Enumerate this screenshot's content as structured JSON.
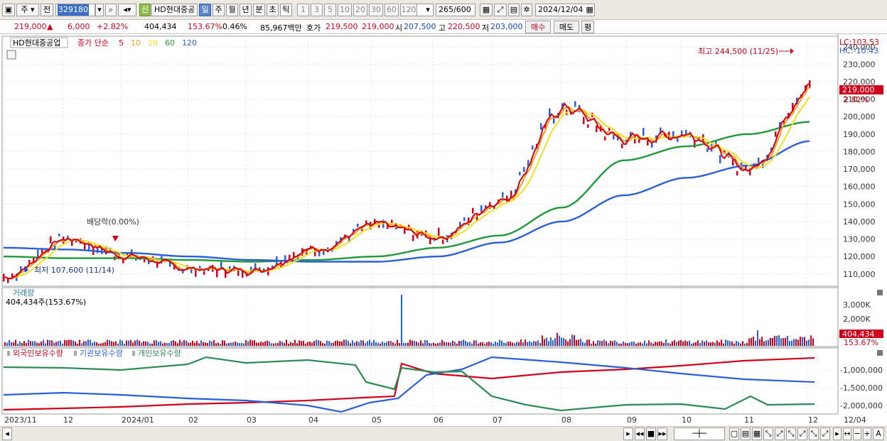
{
  "toolbar": {
    "market_select": "주",
    "prev_label": "전",
    "stock_code": "329180",
    "new_badge": "신",
    "stock_name": "HD현대중공",
    "periods": [
      "일",
      "주",
      "월",
      "년",
      "분",
      "초",
      "틱"
    ],
    "active_period": "일",
    "intervals": [
      "1",
      "3",
      "5",
      "10",
      "20",
      "30",
      "60",
      "120"
    ],
    "count": "265",
    "count_total": "/600",
    "date": "2024/12/04"
  },
  "quote": {
    "price": "219,000",
    "change": "6,000",
    "change_pct": "+2.82%",
    "volume": "404,434",
    "volume_ratio": "153.67%",
    "turnover": "0.46%",
    "amount": "85,967백만",
    "bid_label": "호가",
    "bid": "219,500",
    "ask": "219,000",
    "open_label": "시",
    "open": "207,500",
    "high_label": "고",
    "high": "220,500",
    "low_label": "저",
    "low": "203,000",
    "buy_label": "매수",
    "sell_label": "매도",
    "eval_label": "평"
  },
  "price_panel": {
    "legend_name": "HD현대중공업",
    "legend_ma_label": "종가 단순",
    "ma_periods": [
      "5",
      "10",
      "20",
      "60",
      "120"
    ],
    "ma_colors": [
      "#d0021b",
      "#e8a020",
      "#f0e020",
      "#1e9a3a",
      "#2a5fd8"
    ],
    "lc_label": "LC:103.53",
    "hc_label": "HC:-10.43",
    "price_tag": "219,000",
    "pct_tag": "2.82%",
    "max_annotation": "최고 244,500 (11/25)",
    "min_annotation": "최저 107,600 (11/14)",
    "dividend_annotation": "배당락(0.00%)",
    "y_ticks": [
      "240,000",
      "230,000",
      "220,000",
      "210,000",
      "200,000",
      "190,000",
      "180,000",
      "170,000",
      "160,000",
      "150,000",
      "140,000",
      "130,000",
      "120,000",
      "110,000"
    ]
  },
  "volume_panel": {
    "title": "거래량",
    "value": "404,434주(153.67%)",
    "y_ticks": [
      "3,000K",
      "2,000K"
    ],
    "tag_value": "404,434",
    "tag_pct": "153.67%"
  },
  "holding_panel": {
    "legend": [
      "외국인보유수량",
      "기관보유수량",
      "개인보유수량"
    ],
    "colors": [
      "#d0021b",
      "#2a5fd8",
      "#2e8b57"
    ],
    "y_ticks": [
      "-1,000,000",
      "-1,500,000",
      "-2,000,000"
    ]
  },
  "x_axis": [
    "2023/11",
    "12",
    "2024/01",
    "02",
    "03",
    "04",
    "05",
    "06",
    "07",
    "08",
    "09",
    "10",
    "11",
    "12",
    "12/04"
  ],
  "chart_data": {
    "type": "line",
    "title": "HD현대중공업",
    "series": [
      {
        "name": "종가",
        "x": [
          "2023/11",
          "2023/12",
          "2024/01",
          "2024/02",
          "2024/03",
          "2024/04",
          "2024/05",
          "2024/06",
          "2024/07",
          "2024/08",
          "2024/09",
          "2024/10",
          "2024/11",
          "2024/12"
        ],
        "values": [
          108000,
          130000,
          120000,
          113000,
          112000,
          124000,
          138000,
          131000,
          152000,
          205000,
          187000,
          190000,
          170000,
          219000
        ]
      },
      {
        "name": "120",
        "values": [
          125000,
          124000,
          122000,
          120000,
          118000,
          117000,
          117000,
          120000,
          128000,
          140000,
          155000,
          165000,
          172000,
          186000
        ]
      },
      {
        "name": "60",
        "values": [
          120000,
          119000,
          119000,
          118000,
          117000,
          118000,
          120000,
          125000,
          132000,
          148000,
          175000,
          183000,
          190000,
          197000
        ]
      }
    ],
    "ylim": [
      103000,
      246000
    ],
    "max": {
      "value": 244500,
      "date": "11/25"
    },
    "min": {
      "value": 107600,
      "date": "11/14"
    }
  }
}
